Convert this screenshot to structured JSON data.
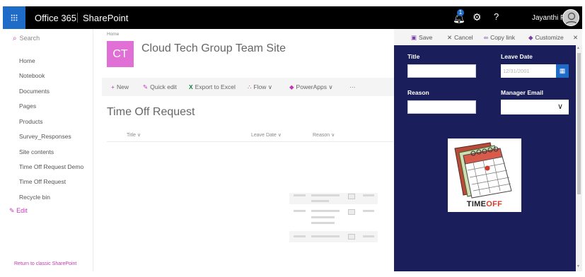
{
  "suitebar": {
    "brand": "Office 365",
    "app": "SharePoint",
    "notification_count": "1",
    "help": "?",
    "user_name": "Jayanthi P",
    "accent_color": "#1f6bc8"
  },
  "leftnav": {
    "search_placeholder": "Search",
    "items": [
      {
        "label": "Home"
      },
      {
        "label": "Notebook"
      },
      {
        "label": "Documents"
      },
      {
        "label": "Pages"
      },
      {
        "label": "Products"
      },
      {
        "label": "Survey_Responses"
      },
      {
        "label": "Site contents"
      },
      {
        "label": "Time Off Request Demo"
      },
      {
        "label": "Time Off Request"
      },
      {
        "label": "Recycle bin"
      }
    ],
    "edit_label": "Edit",
    "return_label": "Return to classic SharePoint",
    "link_color": "#c239b3"
  },
  "site": {
    "breadcrumb": "Home",
    "logo_text": "CT",
    "title": "Cloud Tech Group Team Site",
    "logo_color": "#e06fd6"
  },
  "commandbar": {
    "new": "New",
    "quick_edit": "Quick edit",
    "export": "Export to Excel",
    "flow": "Flow",
    "powerapps": "PowerApps",
    "more": "···"
  },
  "list": {
    "title": "Time Off Request",
    "columns": [
      "Title",
      "Leave Date",
      "Reason"
    ]
  },
  "panel": {
    "toolbar": {
      "save": "Save",
      "cancel": "Cancel",
      "copy_link": "Copy link",
      "customize": "Customize"
    },
    "form": {
      "title_label": "Title",
      "title_value": "",
      "leave_date_label": "Leave Date",
      "leave_date_placeholder": "12/31/2001",
      "reason_label": "Reason",
      "reason_value": "",
      "manager_label": "Manager Email",
      "manager_value": "",
      "image_caption_main": "TIME",
      "image_caption_accent": "OFF",
      "background_color": "#1a1f5c"
    }
  }
}
